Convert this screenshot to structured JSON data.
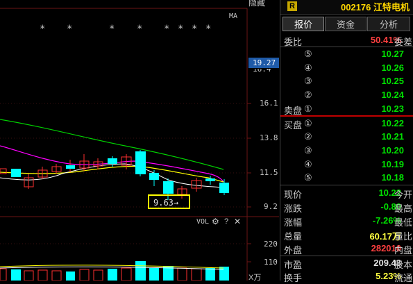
{
  "chart": {
    "top_label": "隐藏",
    "ma_label": "MA",
    "vol_label": "VOL",
    "price_axis": [
      "19.27",
      "16.4",
      "16.1",
      "13.8",
      "11.5",
      "9.2"
    ],
    "vol_axis": [
      "220",
      "110"
    ],
    "vol_unit": "X万",
    "low_marker": "9.63→",
    "stars": [
      "*",
      "*",
      "*",
      "*",
      "*",
      "*",
      "*",
      "*"
    ],
    "colors": {
      "up": "#ff3030",
      "down": "#00ffff",
      "ma_green": "#00d000",
      "ma_magenta": "#ff00ff",
      "ma_yellow": "#ffff00",
      "ma_white": "#ffffff",
      "axis_highlight": "#1e5aa8"
    }
  },
  "panel": {
    "badge": "R",
    "title": "002176 江特电机",
    "tabs": [
      "报价",
      "资金",
      "分析"
    ],
    "weibi_label": "委比",
    "weibi_value": "50.41%",
    "weicha_label": "委差",
    "sell_label": "卖盘",
    "buy_label": "买盘",
    "sell_levels": [
      {
        "num": "⑤",
        "price": "10.27"
      },
      {
        "num": "④",
        "price": "10.26"
      },
      {
        "num": "③",
        "price": "10.25"
      },
      {
        "num": "②",
        "price": "10.24"
      },
      {
        "num": "①",
        "price": "10.23"
      }
    ],
    "buy_levels": [
      {
        "num": "①",
        "price": "10.22"
      },
      {
        "num": "②",
        "price": "10.21"
      },
      {
        "num": "③",
        "price": "10.20"
      },
      {
        "num": "④",
        "price": "10.19"
      },
      {
        "num": "⑤",
        "price": "10.18"
      }
    ],
    "quotes": [
      {
        "label": "现价",
        "value": "10.22",
        "right": "今开",
        "cls": "green"
      },
      {
        "label": "涨跌",
        "value": "-0.80",
        "right": "最高",
        "cls": "green"
      },
      {
        "label": "涨幅",
        "value": "-7.26%",
        "right": "最低",
        "cls": "green"
      },
      {
        "label": "总量",
        "value": "60.17万",
        "right": "量比",
        "cls": "yellow"
      },
      {
        "label": "外盘",
        "value": "282010",
        "right": "内盘",
        "cls": "red"
      },
      {
        "label": "市盈",
        "value": "209.43",
        "right": "股本",
        "cls": "white"
      },
      {
        "label": "换手",
        "value": "5.23%",
        "right": "流通",
        "cls": "yellow"
      }
    ]
  }
}
